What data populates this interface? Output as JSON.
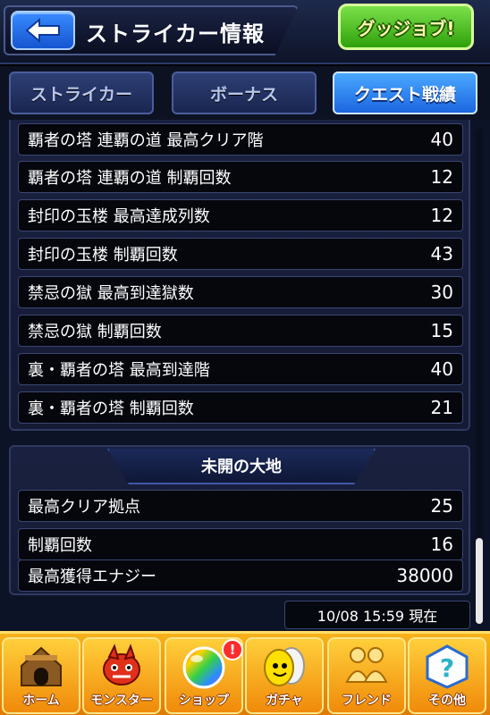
{
  "header": {
    "title": "ストライカー情報",
    "good_job_label": "グッジョブ!"
  },
  "tabs": [
    {
      "label": "ストライカー",
      "active": false
    },
    {
      "label": "ボーナス",
      "active": false
    },
    {
      "label": "クエスト戦績",
      "active": true
    }
  ],
  "stats_upper": [
    {
      "label": "覇者の塔 連覇の道 最高クリア階",
      "value": "40"
    },
    {
      "label": "覇者の塔 連覇の道 制覇回数",
      "value": "12"
    },
    {
      "label": "封印の玉楼 最高達成列数",
      "value": "12"
    },
    {
      "label": "封印の玉楼 制覇回数",
      "value": "43"
    },
    {
      "label": "禁忌の獄 最高到達獄数",
      "value": "30"
    },
    {
      "label": "禁忌の獄 制覇回数",
      "value": "15"
    },
    {
      "label": "裏・覇者の塔 最高到達階",
      "value": "40"
    },
    {
      "label": "裏・覇者の塔 制覇回数",
      "value": "21"
    }
  ],
  "section_mikai": {
    "title": "未開の大地",
    "rows": [
      {
        "label": "最高クリア拠点",
        "value": "25"
      },
      {
        "label": "制覇回数",
        "value": "16"
      },
      {
        "label": "最高獲得エナジー",
        "value": "38000"
      }
    ]
  },
  "timestamp": "10/08 15:59 現在",
  "bottom_nav": [
    {
      "label": "ホーム",
      "icon": "home-icon"
    },
    {
      "label": "モンスター",
      "icon": "monster-icon"
    },
    {
      "label": "ショップ",
      "icon": "shop-orb-icon",
      "badge": "!"
    },
    {
      "label": "ガチャ",
      "icon": "gacha-egg-icon"
    },
    {
      "label": "フレンド",
      "icon": "friend-icon"
    },
    {
      "label": "その他",
      "icon": "other-icon"
    }
  ],
  "colors": {
    "accent_blue": "#1c66e0",
    "nav_orange": "#f08a0a",
    "good_job_green": "#2fa10c"
  }
}
